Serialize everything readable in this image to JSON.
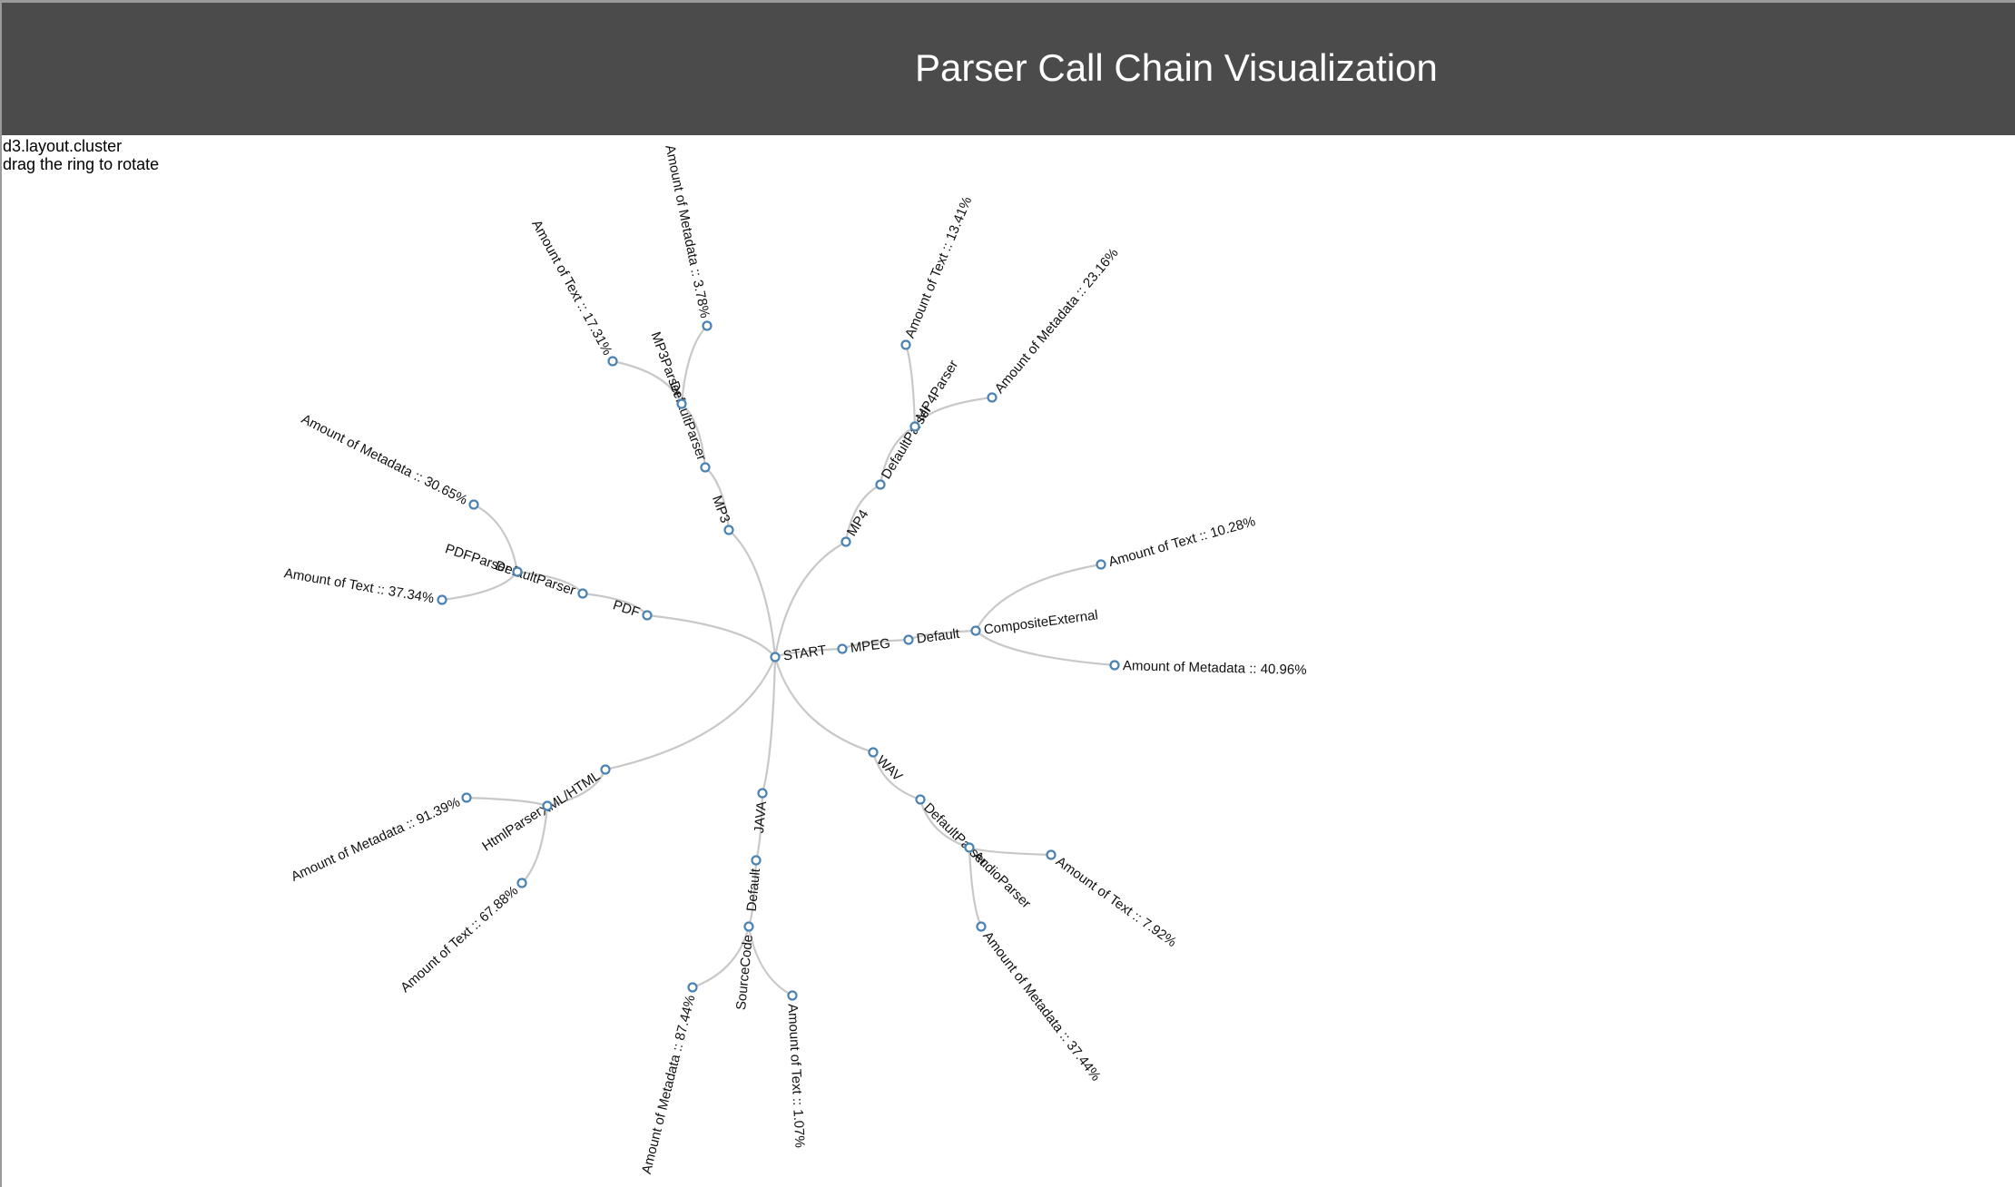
{
  "header": {
    "title": "Parser Call Chain Visualization"
  },
  "info": {
    "line1": "d3.layout.cluster",
    "line2": "drag the ring to rotate"
  },
  "tree": {
    "name": "START",
    "children": [
      {
        "name": "MPEG",
        "children": [
          {
            "name": "Default",
            "children": [
              {
                "name": "CompositeExternal",
                "children": [
                  {
                    "name": "Amount of Text :: 10.28%"
                  },
                  {
                    "name": "Amount of Metadata :: 40.96%"
                  }
                ]
              }
            ]
          }
        ]
      },
      {
        "name": "MP4",
        "children": [
          {
            "name": "DefaultParser",
            "children": [
              {
                "name": "MP4Parser",
                "children": [
                  {
                    "name": "Amount of Text :: 13.41%"
                  },
                  {
                    "name": "Amount of Metadata :: 23.16%"
                  }
                ]
              }
            ]
          }
        ]
      },
      {
        "name": "MP3",
        "children": [
          {
            "name": "DefaultParser",
            "children": [
              {
                "name": "MP3Parser",
                "children": [
                  {
                    "name": "Amount of Metadata :: 3.78%"
                  },
                  {
                    "name": "Amount of Text :: 17.31%"
                  }
                ]
              }
            ]
          }
        ]
      },
      {
        "name": "PDF",
        "children": [
          {
            "name": "DefaultParser",
            "children": [
              {
                "name": "PDFParser",
                "children": [
                  {
                    "name": "Amount of Metadata :: 30.65%"
                  },
                  {
                    "name": "Amount of Text :: 37.34%"
                  }
                ]
              }
            ]
          }
        ]
      },
      {
        "name": "XML/HTML",
        "children": [
          {
            "name": "HtmlParser",
            "children": [
              {
                "name": "Amount of Metadata :: 91.39%"
              },
              {
                "name": "Amount of Text :: 67.88%"
              }
            ]
          }
        ]
      },
      {
        "name": "JAVA",
        "children": [
          {
            "name": "Default",
            "children": [
              {
                "name": "SourceCode",
                "children": [
                  {
                    "name": "Amount of Metadata :: 87.44%"
                  },
                  {
                    "name": "Amount of Text :: 1.07%"
                  }
                ]
              }
            ]
          }
        ]
      },
      {
        "name": "WAV",
        "children": [
          {
            "name": "DefaultParser",
            "children": [
              {
                "name": "AudioParser",
                "children": [
                  {
                    "name": "Amount of Text :: 7.92%"
                  },
                  {
                    "name": "Amount of Metadata :: 37.44%"
                  }
                ]
              }
            ]
          }
        ]
      }
    ]
  },
  "colors": {
    "header_bg": "#4b4b4b",
    "node_stroke": "#4a82b4",
    "link": "#c8c8c8"
  }
}
